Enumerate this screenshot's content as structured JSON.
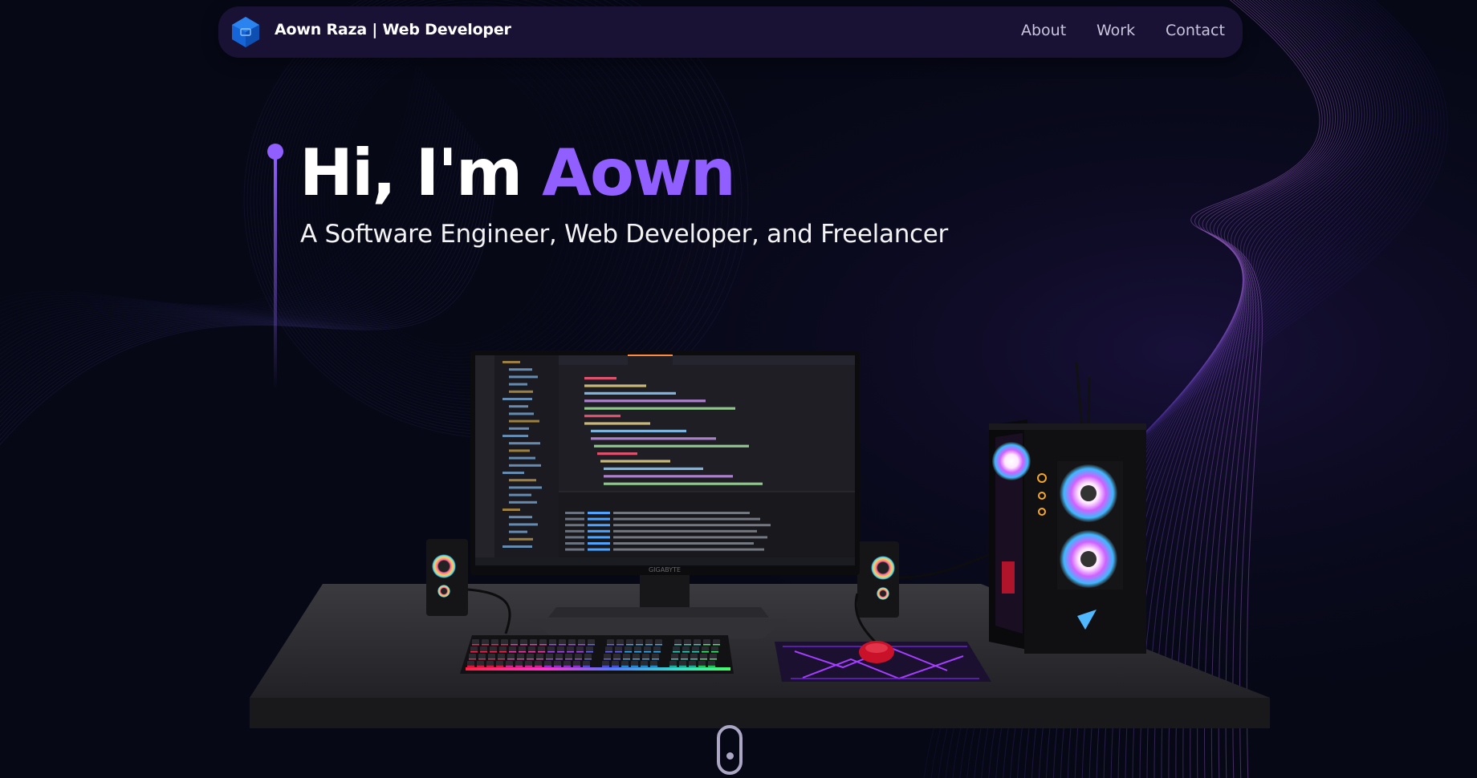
{
  "navbar": {
    "brand": "Aown Raza | Web Developer",
    "logo_icon": "hexagon-logo-icon",
    "links": [
      {
        "label": "About"
      },
      {
        "label": "Work"
      },
      {
        "label": "Contact"
      }
    ]
  },
  "hero": {
    "greeting": "Hi, I'm ",
    "name": "Aown",
    "subtitle": "A Software Engineer, Web Developer, and Freelancer"
  },
  "scene": {
    "monitor_brand": "GIGABYTE"
  },
  "colors": {
    "background": "#060816",
    "navbar": "#1a1235",
    "accent": "#915eff",
    "text": "#ffffff",
    "muted": "#aaa6c3"
  },
  "icons": [
    "hexagon-logo-icon",
    "scroll-down-icon"
  ]
}
